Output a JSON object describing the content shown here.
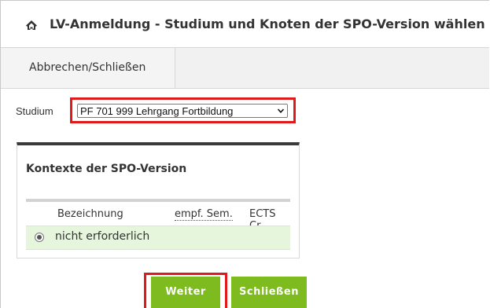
{
  "header": {
    "title": "LV-Anmeldung - Studium und Knoten der SPO-Version wählen",
    "icon": "home-icon"
  },
  "toolbar": {
    "cancel_close_label": "Abbrechen/Schließen"
  },
  "studium": {
    "label": "Studium",
    "selected": "PF 701 999 Lehrgang Fortbildung",
    "highlight_color": "#e0191b"
  },
  "context_panel": {
    "title": "Kontexte der SPO-Version",
    "columns": [
      "Bezeichnung",
      "empf. Sem.",
      "ECTS Cr."
    ],
    "rows": [
      {
        "label": "nicht erforderlich",
        "selected": true
      }
    ],
    "row_color": "#e6f6dd"
  },
  "actions": {
    "weiter_label": "Weiter",
    "schliessen_label": "Schließen",
    "button_color": "#7dbb1e"
  }
}
